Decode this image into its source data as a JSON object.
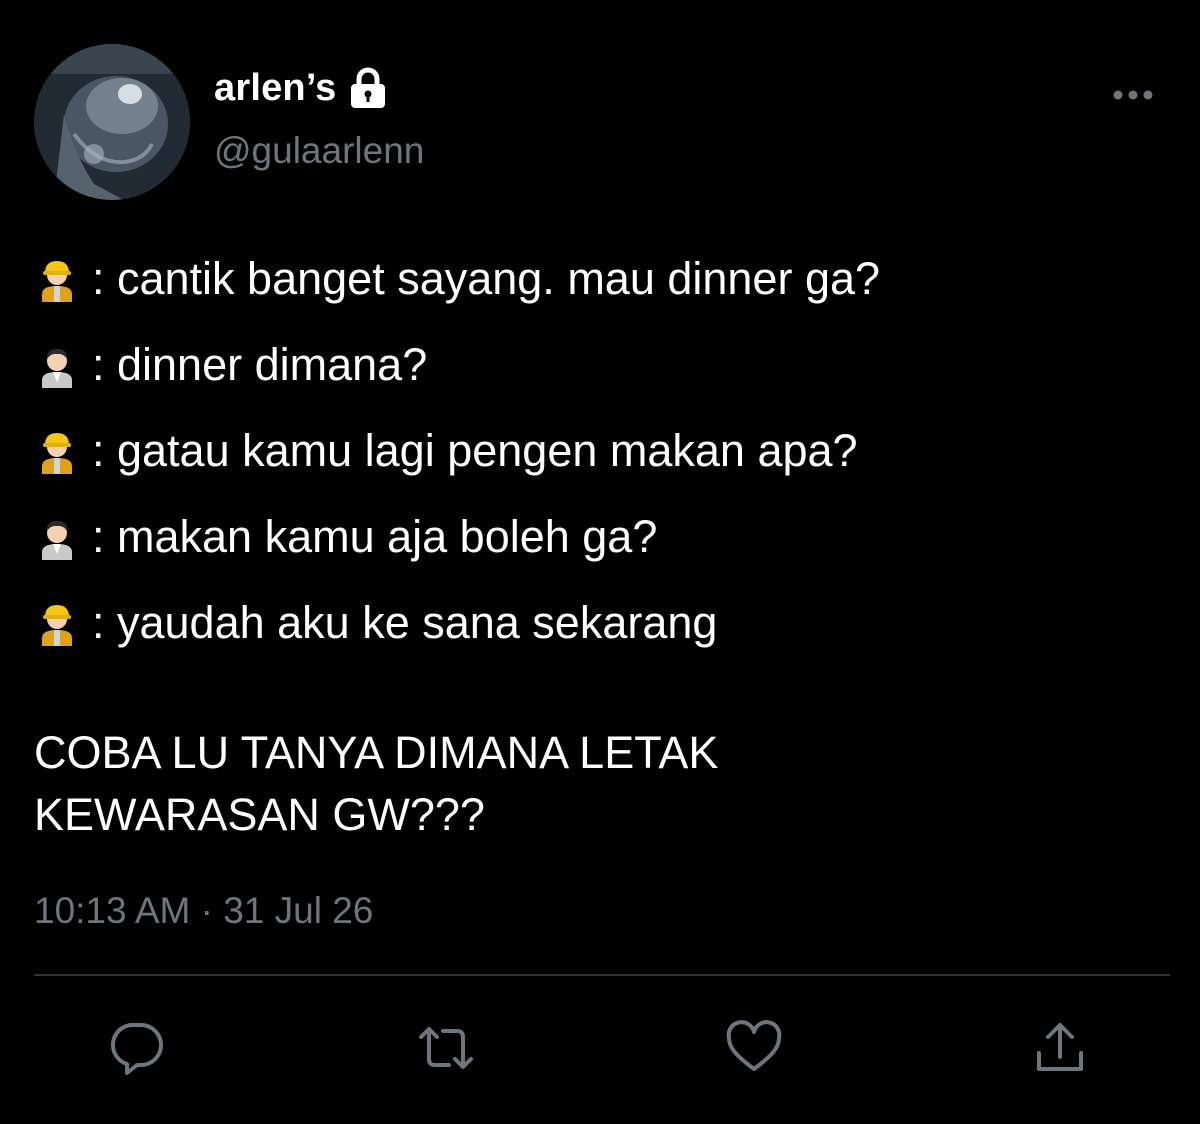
{
  "tweet": {
    "display_name": "arlen’s",
    "handle": "@gulaarlenn",
    "verified_icon": "lock-icon",
    "dialog": [
      {
        "speaker": "construction-worker-icon",
        "text": ": cantik banget sayang. mau dinner ga?"
      },
      {
        "speaker": "office-worker-icon",
        "text": ": dinner dimana?"
      },
      {
        "speaker": "construction-worker-icon",
        "text": ": gatau kamu lagi pengen makan apa?"
      },
      {
        "speaker": "office-worker-icon",
        "text": ": makan kamu aja boleh ga?"
      },
      {
        "speaker": "construction-worker-icon",
        "text": ": yaudah aku ke sana sekarang"
      }
    ],
    "closing": "COBA LU TANYA DIMANA LETAK\nKEWARASAN GW???",
    "timestamp": "10:13 AM · 31 Jul 26"
  },
  "actions": {
    "reply_icon": "reply-icon",
    "retweet_icon": "retweet-icon",
    "like_icon": "heart-icon",
    "share_icon": "share-icon"
  },
  "colors": {
    "background": "#000000",
    "text": "#ffffff",
    "secondary": "#6e767d",
    "divider": "#2f3336"
  }
}
